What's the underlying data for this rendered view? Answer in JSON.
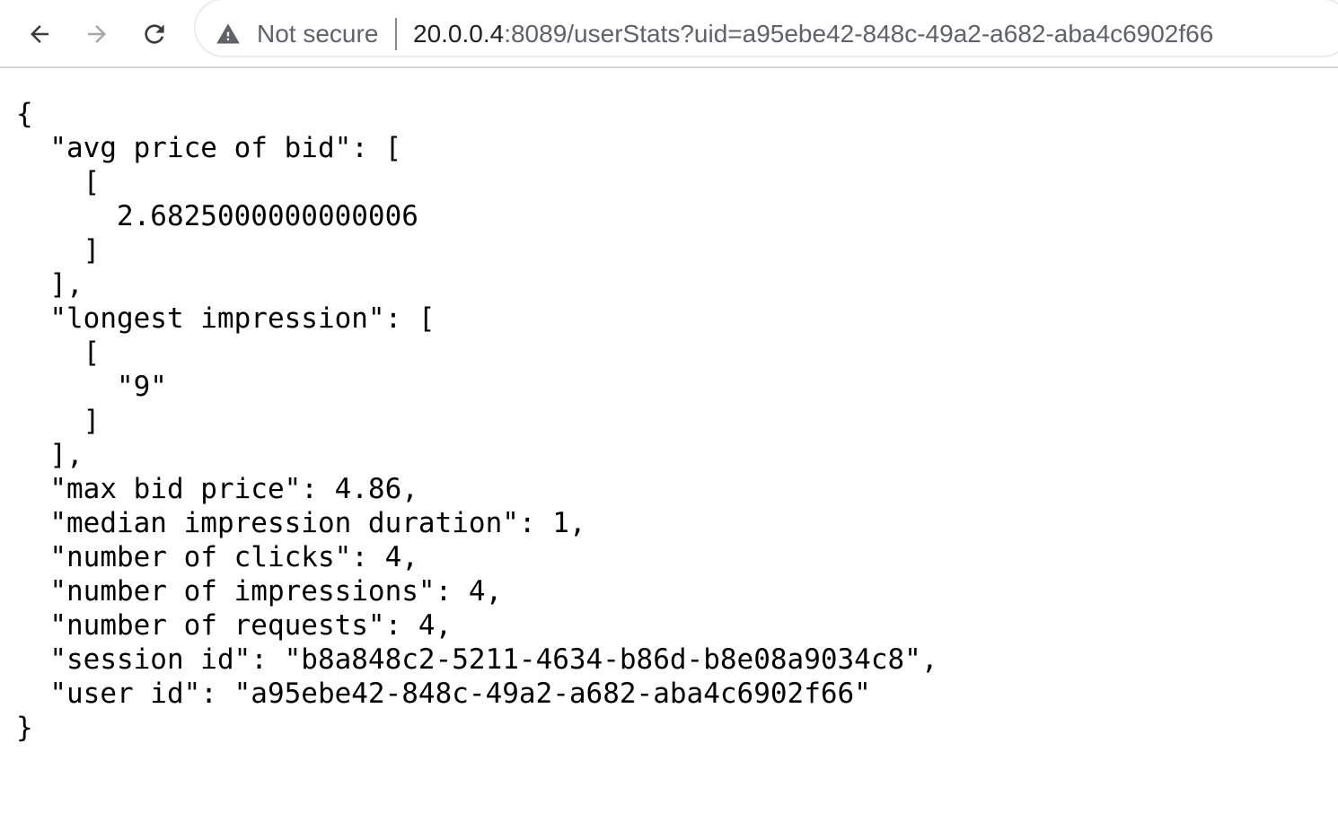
{
  "browser": {
    "security_label": "Not secure",
    "url_host": "20.0.0.4",
    "url_rest": ":8089/userStats?uid=a95ebe42-848c-49a2-a682-aba4c6902f66",
    "icons": {
      "back": "back-arrow-icon",
      "forward": "forward-arrow-icon",
      "reload": "reload-icon",
      "security": "warning-triangle-icon"
    }
  },
  "json_view": {
    "lines": [
      "{",
      "  \"avg price of bid\": [",
      "    [",
      "      2.6825000000000006",
      "    ]",
      "  ],",
      "  \"longest impression\": [",
      "    [",
      "      \"9\"",
      "    ]",
      "  ],",
      "  \"max bid price\": 4.86,",
      "  \"median impression duration\": 1,",
      "  \"number of clicks\": 4,",
      "  \"number of impressions\": 4,",
      "  \"number of requests\": 4,",
      "  \"session id\": \"b8a848c2-5211-4634-b86d-b8e08a9034c8\",",
      "  \"user id\": \"a95ebe42-848c-49a2-a682-aba4c6902f66\"",
      "}"
    ]
  }
}
